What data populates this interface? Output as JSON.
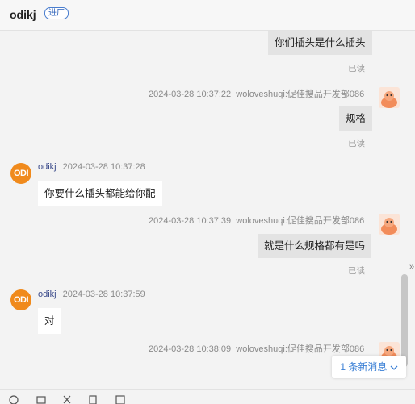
{
  "header": {
    "title": "odikj",
    "badge": "进厂"
  },
  "messages": {
    "out1": {
      "text": "你们插头是什么插头",
      "read": "已读"
    },
    "out2": {
      "time": "2024-03-28 10:37:22",
      "sender": "woloveshuqi:促佳搜品开发部086",
      "text": "规格",
      "read": "已读"
    },
    "in1": {
      "name": "odikj",
      "time": "2024-03-28 10:37:28",
      "text": "你要什么插头都能给你配",
      "avatar": "ODI"
    },
    "out3": {
      "time": "2024-03-28 10:37:39",
      "sender": "woloveshuqi:促佳搜品开发部086",
      "text": "就是什么规格都有是吗",
      "read": "已读"
    },
    "in2": {
      "name": "odikj",
      "time": "2024-03-28 10:37:59",
      "text": "对",
      "avatar": "ODI"
    },
    "out4": {
      "time": "2024-03-28 10:38:09",
      "sender": "woloveshuqi:促佳搜品开发部086"
    }
  },
  "new_message_notice": "1 条新消息",
  "colors": {
    "accent": "#3a7fd5",
    "avatar_orange": "#f08a1c",
    "outgoing_bubble": "#e3e3e3"
  },
  "icons": [
    "emoji-icon",
    "screenshot-icon",
    "scissors-icon",
    "file-icon",
    "image-icon"
  ]
}
